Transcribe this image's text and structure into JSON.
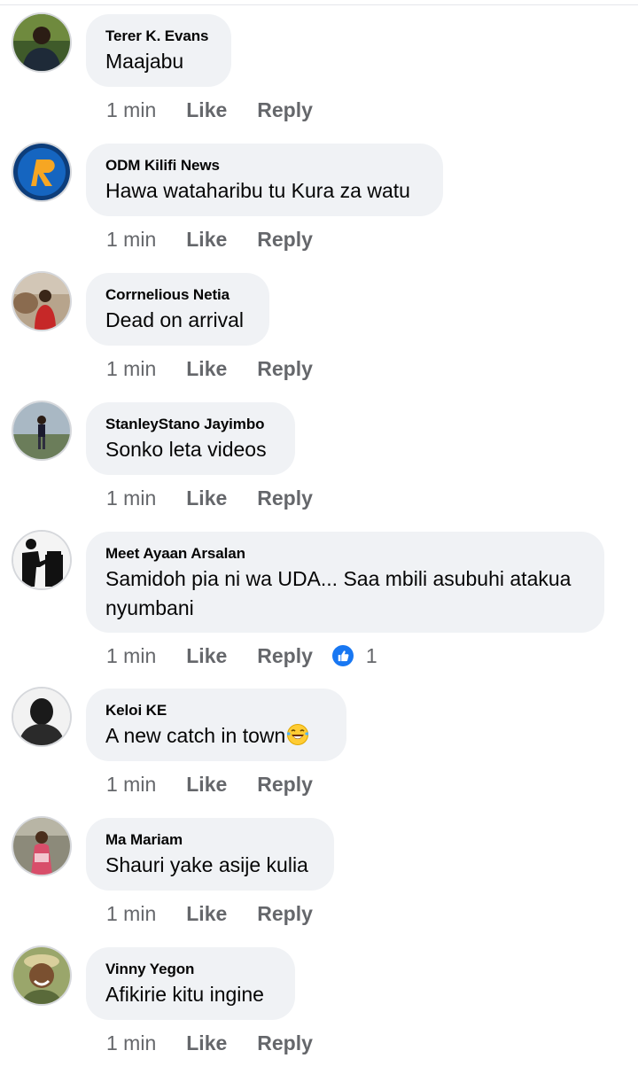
{
  "comments": [
    {
      "author": "Terer K. Evans",
      "text": "Maajabu",
      "time": "1 min",
      "like_label": "Like",
      "reply_label": "Reply",
      "avatar": "profile-photo"
    },
    {
      "author": "ODM Kilifi News",
      "text": "Hawa wataharibu tu Kura za watu",
      "time": "1 min",
      "like_label": "Like",
      "reply_label": "Reply",
      "avatar": "page-logo"
    },
    {
      "author": "Corrnelious Netia",
      "text": "Dead on arrival",
      "time": "1 min",
      "like_label": "Like",
      "reply_label": "Reply",
      "avatar": "profile-photo"
    },
    {
      "author": "StanleyStano Jayimbo",
      "text": "Sonko leta videos",
      "time": "1 min",
      "like_label": "Like",
      "reply_label": "Reply",
      "avatar": "profile-photo"
    },
    {
      "author": "Meet Ayaan Arsalan",
      "text_line1": "Samidoh pia ni wa UDA... Saa mbili asubuhi atakua",
      "text_line2": "nyumbani",
      "time": "1 min",
      "like_label": "Like",
      "reply_label": "Reply",
      "reaction_icon": "thumbs-up-icon",
      "reaction_count": "1",
      "avatar": "speaker-silhouette"
    },
    {
      "author": "Keloi KE",
      "text": "A new catch in town",
      "emoji": "laughing-tears-emoji",
      "time": "1 min",
      "like_label": "Like",
      "reply_label": "Reply",
      "avatar": "profile-photo"
    },
    {
      "author": "Ma Mariam",
      "text": "Shauri yake asije kulia",
      "time": "1 min",
      "like_label": "Like",
      "reply_label": "Reply",
      "avatar": "profile-photo"
    },
    {
      "author": "Vinny Yegon",
      "text": "Afikirie kitu ingine",
      "time": "1 min",
      "like_label": "Like",
      "reply_label": "Reply",
      "avatar": "profile-photo"
    }
  ],
  "colors": {
    "bubble": "#f0f2f5",
    "meta_text": "#65676b",
    "like_blue": "#1877f2",
    "body_text": "#050505"
  }
}
